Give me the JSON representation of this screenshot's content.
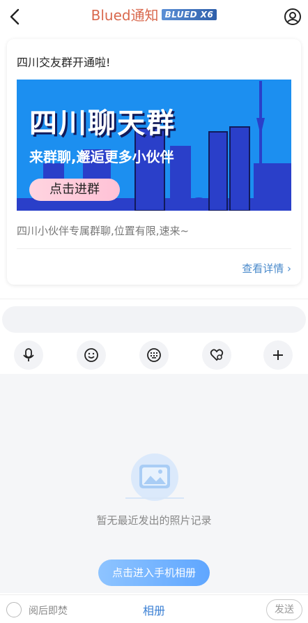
{
  "header": {
    "title": "Blued通知",
    "badge": "BLUED X6"
  },
  "card": {
    "title": "四川交友群开通啦!",
    "banner": {
      "headline": "四川聊天群",
      "subline": "来群聊,邂逅更多小伙伴",
      "button": "点击进群",
      "background_color": "#1a8fe8"
    },
    "description": "四川小伙伴专属群聊,位置有限,速来~",
    "link": "查看详情 ›"
  },
  "input": {
    "placeholder": ""
  },
  "toolbar": {
    "icons": [
      "microphone-icon",
      "emoji-icon",
      "keyboard-icon",
      "heart-sticker-icon",
      "plus-icon"
    ]
  },
  "photo_panel": {
    "empty_text": "暂无最近发出的照片记录",
    "open_album_button": "点击进入手机相册"
  },
  "bottom_bar": {
    "burn_after_read": "阅后即焚",
    "album_tab": "相册",
    "send": "发送"
  },
  "colors": {
    "title": "#d9694e",
    "link": "#3b80d4",
    "panel_bg": "#f5f6f8"
  }
}
